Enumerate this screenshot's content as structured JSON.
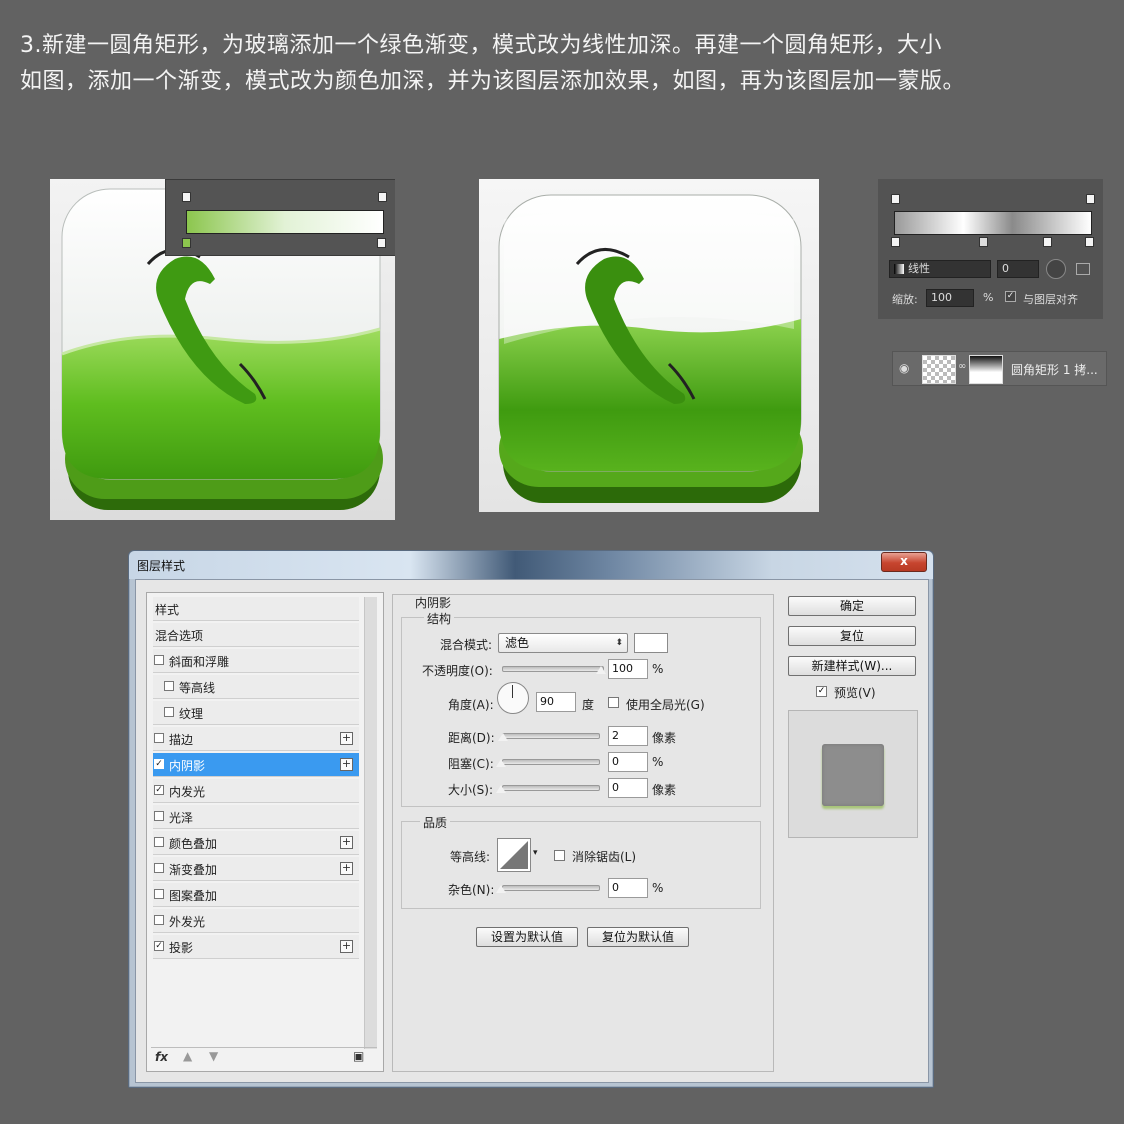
{
  "instruction": {
    "line1": "3.新建一圆角矩形，为玻璃添加一个绿色渐变，模式改为线性加深。再建一个圆角矩形，大小",
    "line2": "如图，添加一个渐变，模式改为颜色加深，并为该图层添加效果，如图，再为该图层加一蒙版。"
  },
  "gradient_panel": {
    "type_label": "线性",
    "angle_value": "0",
    "scale_label": "缩放:",
    "scale_value": "100",
    "scale_unit": "%",
    "align_label": "与图层对齐"
  },
  "layer": {
    "name": "圆角矩形 1 拷..."
  },
  "dialog": {
    "title": "图层样式",
    "close_label": "x",
    "styles_header": "样式",
    "blend_options": "混合选项",
    "items": [
      {
        "label": "斜面和浮雕",
        "checked": false,
        "indent": false,
        "plus": false
      },
      {
        "label": "等高线",
        "checked": false,
        "indent": true,
        "plus": false
      },
      {
        "label": "纹理",
        "checked": false,
        "indent": true,
        "plus": false
      },
      {
        "label": "描边",
        "checked": false,
        "indent": false,
        "plus": true
      },
      {
        "label": "内阴影",
        "checked": true,
        "indent": false,
        "plus": true,
        "selected": true
      },
      {
        "label": "内发光",
        "checked": true,
        "indent": false,
        "plus": false
      },
      {
        "label": "光泽",
        "checked": false,
        "indent": false,
        "plus": false
      },
      {
        "label": "颜色叠加",
        "checked": false,
        "indent": false,
        "plus": true
      },
      {
        "label": "渐变叠加",
        "checked": false,
        "indent": false,
        "plus": true
      },
      {
        "label": "图案叠加",
        "checked": false,
        "indent": false,
        "plus": false
      },
      {
        "label": "外发光",
        "checked": false,
        "indent": false,
        "plus": false
      },
      {
        "label": "投影",
        "checked": true,
        "indent": false,
        "plus": true
      }
    ],
    "footer_fx": "fx",
    "section_title": "内阴影",
    "structure_label": "结构",
    "blend_mode_label": "混合模式:",
    "blend_mode_value": "滤色",
    "opacity_label": "不透明度(O):",
    "opacity_value": "100",
    "percent": "%",
    "angle_label": "角度(A):",
    "angle_value": "90",
    "degree_unit": "度",
    "global_light_label": "使用全局光(G)",
    "distance_label": "距离(D):",
    "distance_value": "2",
    "pixel_unit": "像素",
    "choke_label": "阻塞(C):",
    "choke_value": "0",
    "size_label": "大小(S):",
    "size_value": "0",
    "quality_label": "品质",
    "contour_label": "等高线:",
    "antialias_label": "消除锯齿(L)",
    "noise_label": "杂色(N):",
    "noise_value": "0",
    "set_default": "设置为默认值",
    "reset_default": "复位为默认值",
    "ok": "确定",
    "reset": "复位",
    "new_style": "新建样式(W)...",
    "preview_label": "预览(V)"
  },
  "colors": {
    "accent_selected": "#3a9af0",
    "icon_green": "#4fae16",
    "close_red": "#c7452f"
  }
}
